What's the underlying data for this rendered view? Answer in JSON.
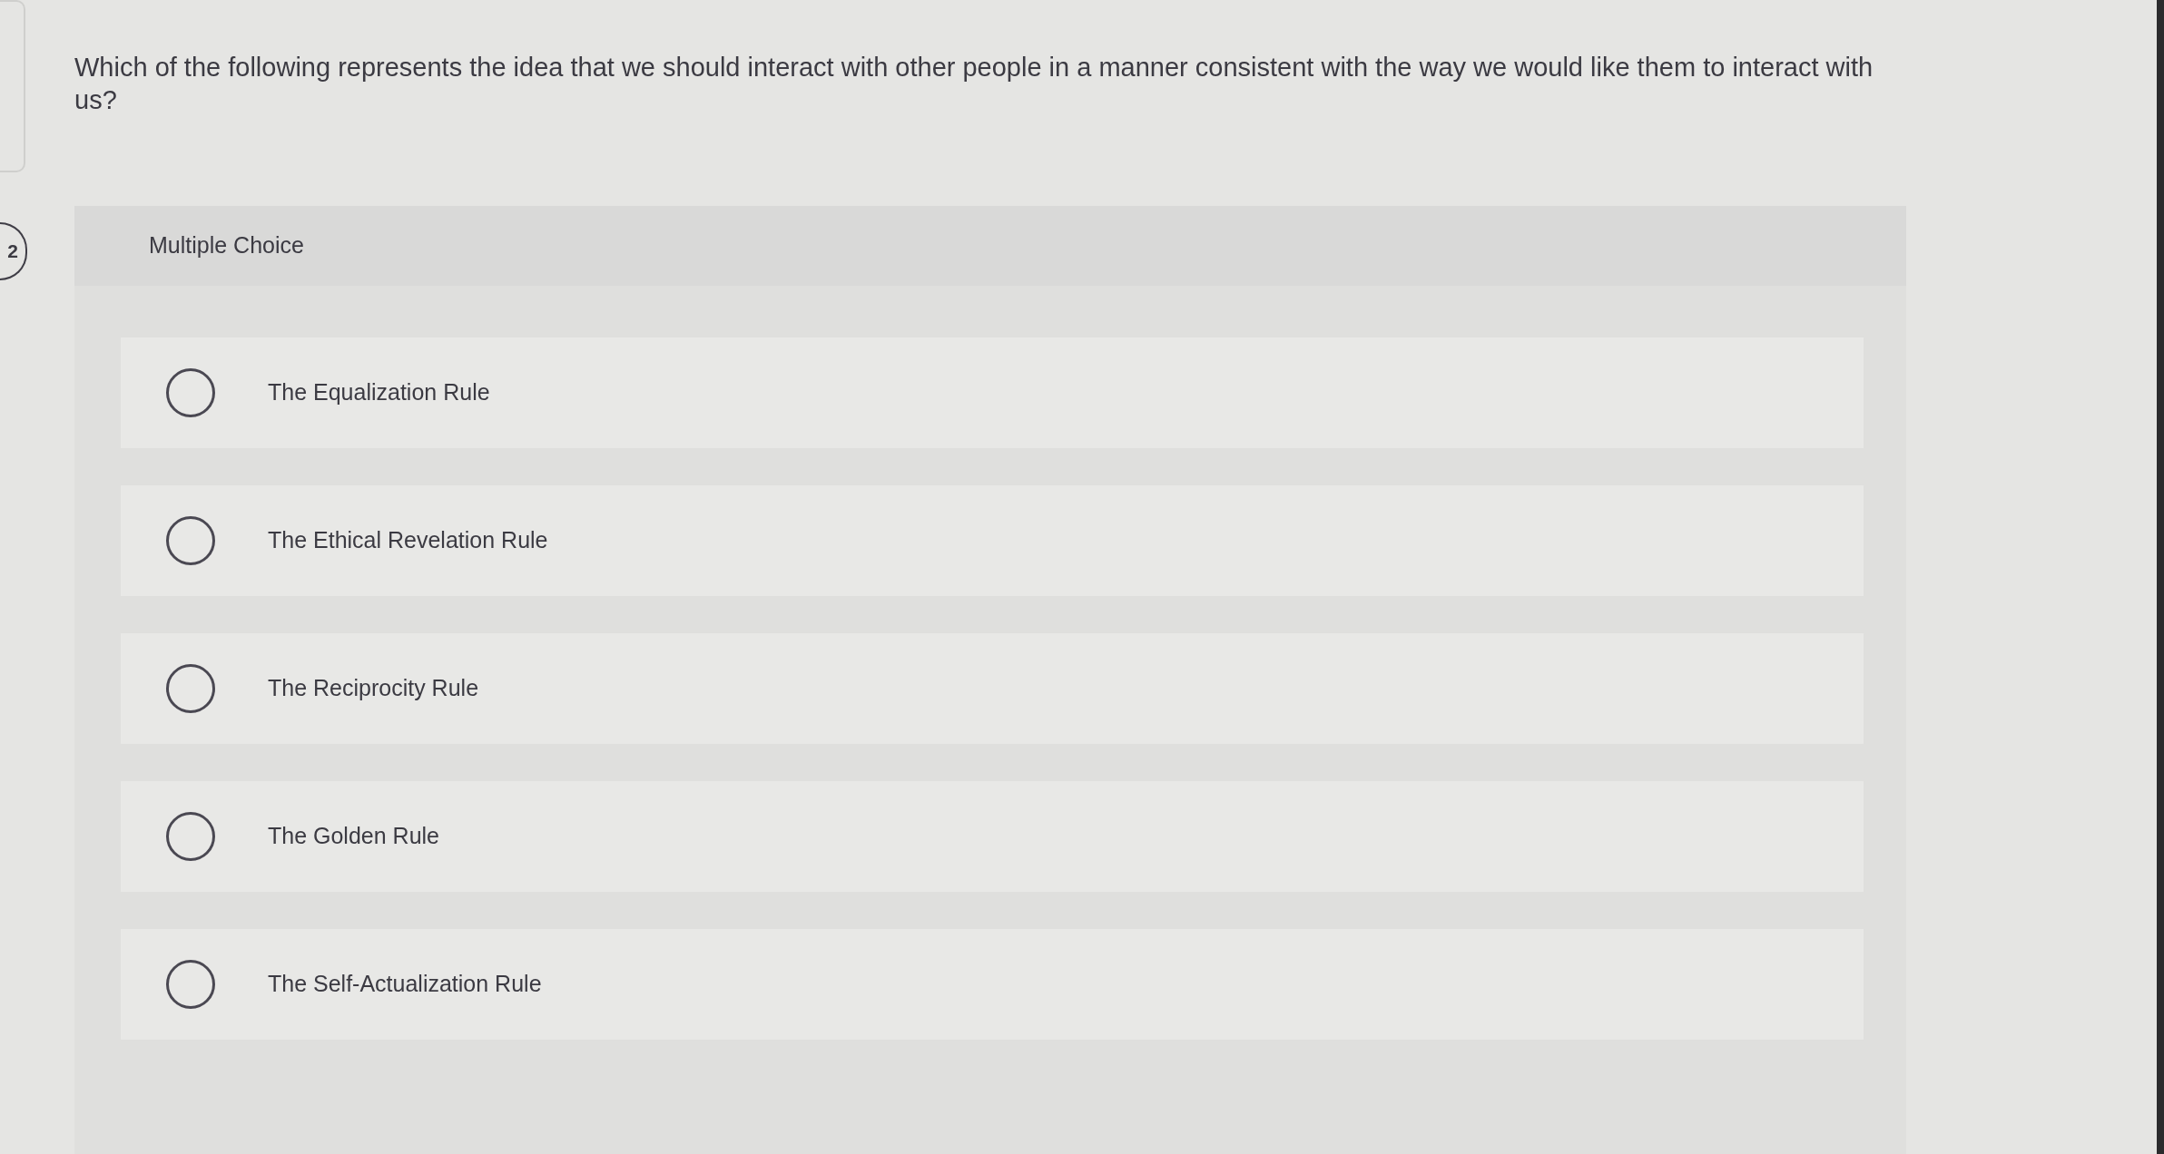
{
  "question_number": "2",
  "question": "Which of the following represents the idea that we should interact with other people in a manner consistent with the way we would like them to interact with us?",
  "answer_panel": {
    "type_label": "Multiple Choice",
    "options": [
      {
        "label": "The Equalization Rule",
        "selected": false
      },
      {
        "label": "The Ethical Revelation Rule",
        "selected": false
      },
      {
        "label": "The Reciprocity Rule",
        "selected": false
      },
      {
        "label": "The Golden Rule",
        "selected": false
      },
      {
        "label": "The Self-Actualization Rule",
        "selected": false
      }
    ]
  }
}
